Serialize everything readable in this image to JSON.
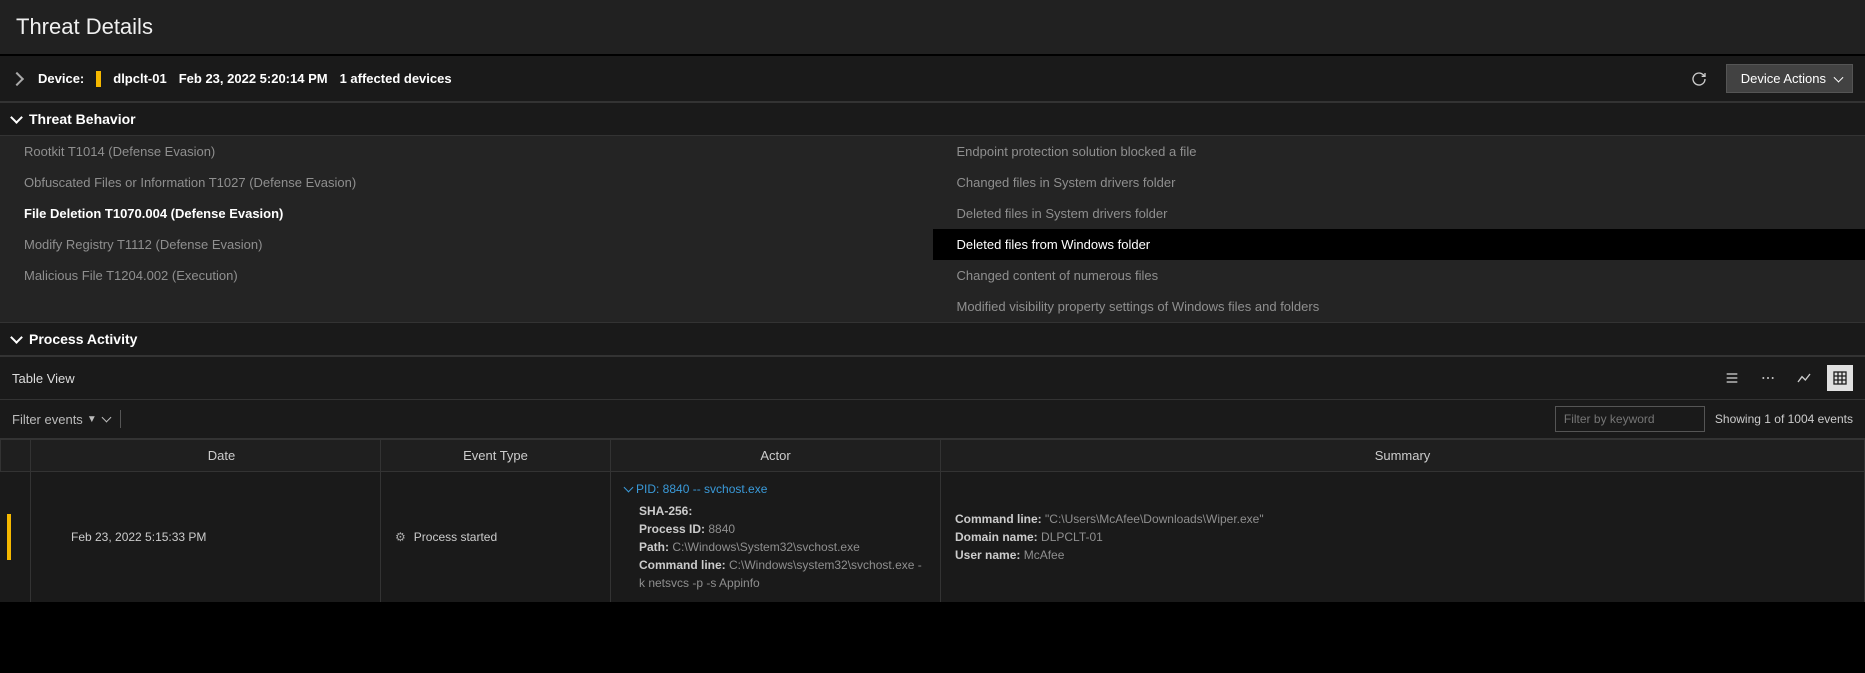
{
  "page_title": "Threat Details",
  "device_bar": {
    "device_label": "Device:",
    "device_name": "dlpclt-01",
    "timestamp": "Feb 23, 2022 5:20:14 PM",
    "affected": "1 affected devices",
    "actions_btn": "Device Actions"
  },
  "sections": {
    "threat_behavior": "Threat Behavior",
    "process_activity": "Process Activity"
  },
  "behavior_left": [
    "Rootkit T1014 (Defense Evasion)",
    "Obfuscated Files or Information T1027 (Defense Evasion)",
    "File Deletion T1070.004 (Defense Evasion)",
    "Modify Registry T1112 (Defense Evasion)",
    "Malicious File T1204.002 (Execution)"
  ],
  "behavior_left_selected": 2,
  "behavior_right": [
    "Endpoint protection solution blocked a file",
    "Changed files in System drivers folder",
    "Deleted files in System drivers folder",
    "Deleted files from Windows folder",
    "Changed content of numerous files",
    "Modified visibility property settings of Windows files and folders"
  ],
  "behavior_right_selected": 3,
  "table_view": {
    "label": "Table View",
    "filter_events": "Filter events",
    "keyword_placeholder": "Filter by keyword",
    "showing": "Showing 1 of 1004 events"
  },
  "columns": {
    "date": "Date",
    "event_type": "Event Type",
    "actor": "Actor",
    "summary": "Summary"
  },
  "row": {
    "date": "Feb 23, 2022 5:15:33 PM",
    "event_type": "Process started",
    "actor": {
      "header": "PID: 8840 -- svchost.exe",
      "sha256_k": "SHA-256:",
      "pid_k": "Process ID:",
      "pid_v": "8840",
      "path_k": "Path:",
      "path_v": "C:\\Windows\\System32\\svchost.exe",
      "cmd_k": "Command line:",
      "cmd_v": "C:\\Windows\\system32\\svchost.exe -k netsvcs -p -s Appinfo"
    },
    "summary": {
      "cmd_k": "Command line:",
      "cmd_v": "\"C:\\Users\\McAfee\\Downloads\\Wiper.exe\"",
      "domain_k": "Domain name:",
      "domain_v": "DLPCLT-01",
      "user_k": "User name:",
      "user_v": "McAfee"
    }
  }
}
